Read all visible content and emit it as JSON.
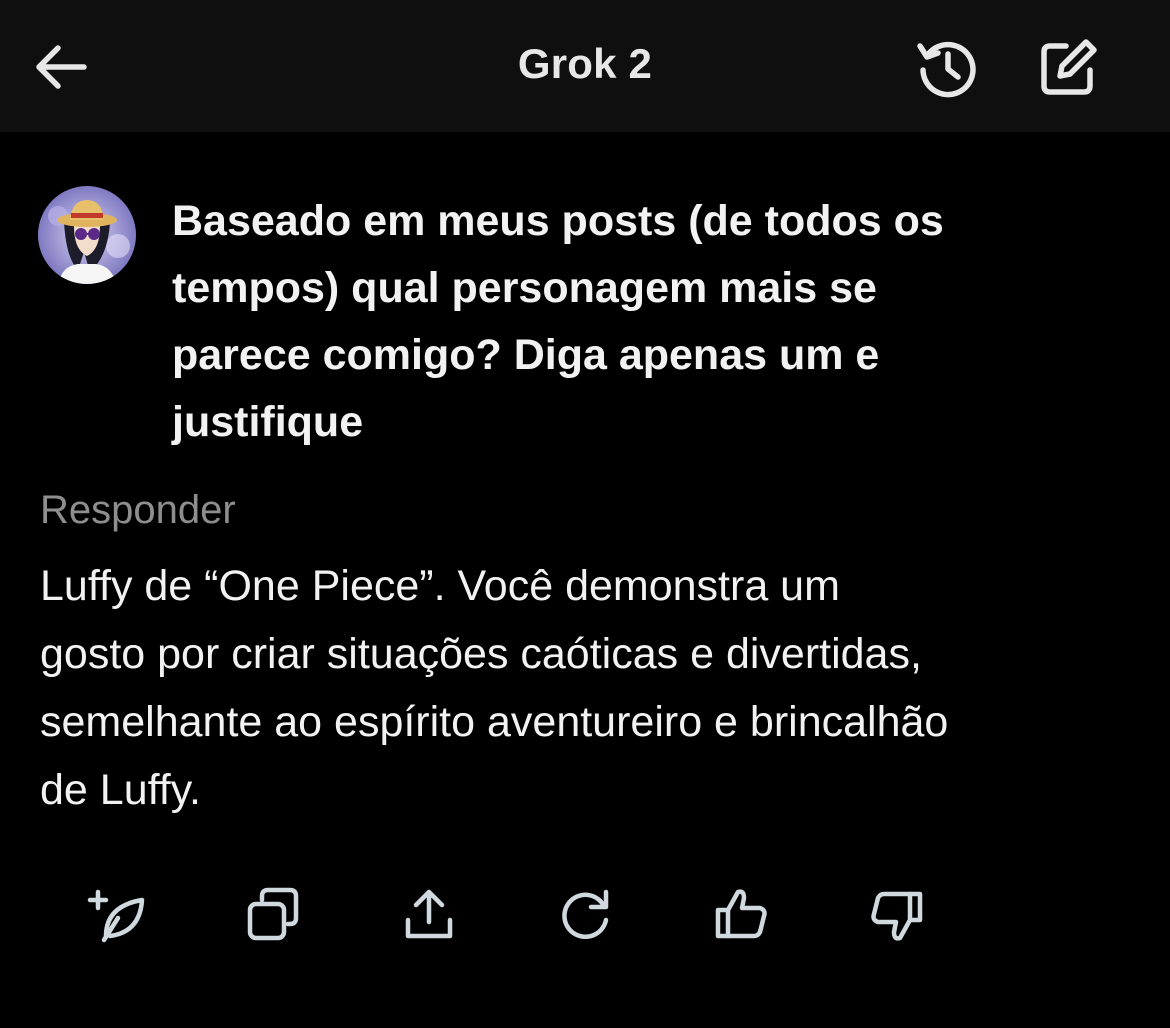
{
  "header": {
    "title": "Grok 2",
    "back_icon": "arrow-left-icon",
    "history_icon": "history-icon",
    "compose_icon": "compose-icon"
  },
  "conversation": {
    "user": {
      "avatar": "anime-character-avatar",
      "message": "Baseado em meus posts (de todos os\ntempos) qual personagem mais se\nparece comigo? Diga apenas um e\njustifique"
    },
    "reply_label": "Responder",
    "answer": "Luffy de “One Piece”. Você demonstra um\ngosto por criar situações caóticas e divertidas,\nsemelhante ao espírito aventureiro e brincalhão\nde Luffy."
  },
  "actions": [
    {
      "icon": "regenerate-sparkle-icon"
    },
    {
      "icon": "copy-icon"
    },
    {
      "icon": "share-icon"
    },
    {
      "icon": "refresh-icon"
    },
    {
      "icon": "thumbs-up-icon"
    },
    {
      "icon": "thumbs-down-icon"
    }
  ],
  "colors": {
    "background": "#000000",
    "header_background": "#0f0f0f",
    "text": "#f2f2f2",
    "muted": "#8e8e8e",
    "icon": "#cfd9de"
  }
}
